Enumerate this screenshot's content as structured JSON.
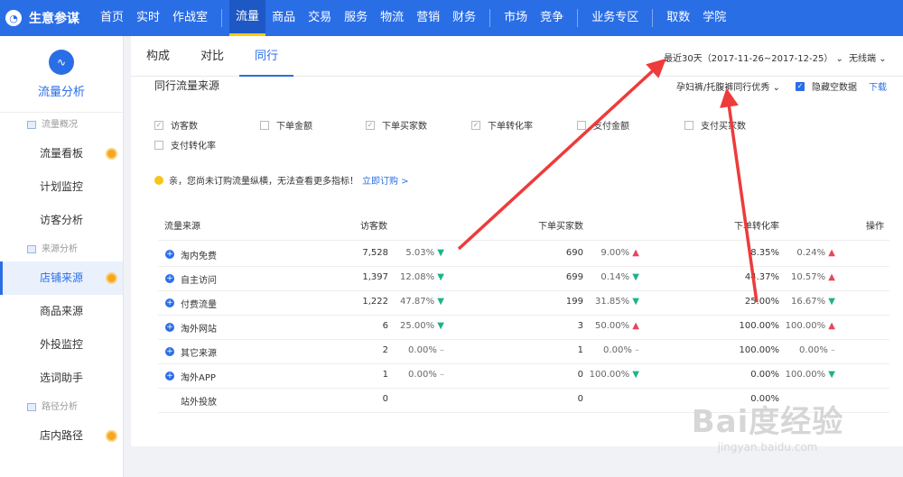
{
  "app": {
    "logo_text": "生意参谋"
  },
  "nav": [
    "首页",
    "实时",
    "作战室",
    "流量",
    "商品",
    "交易",
    "服务",
    "物流",
    "营销",
    "财务",
    "市场",
    "竞争",
    "业务专区",
    "取数",
    "学院"
  ],
  "sidebar": {
    "head_title": "流量分析",
    "groups": [
      {
        "label": "流量概况",
        "items": [
          "流量看板",
          "计划监控",
          "访客分析"
        ]
      },
      {
        "label": "来源分析",
        "items": [
          "店铺来源",
          "商品来源",
          "外投监控",
          "选词助手"
        ]
      },
      {
        "label": "路径分析",
        "items": [
          "店内路径"
        ]
      }
    ]
  },
  "tabs": [
    "构成",
    "对比",
    "同行"
  ],
  "filters": {
    "date_range": "最近30天（2017-11-26~2017-12-25）",
    "device": "无线端",
    "industry": "孕妇裤/托腹裤同行优秀",
    "hide_empty": "隐藏空数据",
    "download": "下载"
  },
  "section_title": "同行流量来源",
  "metrics": [
    {
      "label": "访客数",
      "checked": true
    },
    {
      "label": "下单金额",
      "checked": false
    },
    {
      "label": "下单买家数",
      "checked": true
    },
    {
      "label": "下单转化率",
      "checked": true
    },
    {
      "label": "支付金额",
      "checked": false
    },
    {
      "label": "支付买家数",
      "checked": false
    },
    {
      "label": "支付转化率",
      "checked": false
    }
  ],
  "notice": {
    "text": "亲，您尚未订购流量纵横，无法查看更多指标！",
    "link": "立即订购 >"
  },
  "table": {
    "headers": {
      "source": "流量来源",
      "visitors": "访客数",
      "buyers": "下单买家数",
      "conversion": "下单转化率",
      "action": "操作"
    },
    "rows": [
      {
        "name": "淘内免费",
        "visitors": "7,528",
        "v_pct": "5.03%",
        "v_dir": "down",
        "buyers": "690",
        "b_pct": "9.00%",
        "b_dir": "up",
        "conv": "8.35%",
        "c_pct": "0.24%",
        "c_dir": "up",
        "expand": true
      },
      {
        "name": "自主访问",
        "visitors": "1,397",
        "v_pct": "12.08%",
        "v_dir": "down",
        "buyers": "699",
        "b_pct": "0.14%",
        "b_dir": "down",
        "conv": "44.37%",
        "c_pct": "10.57%",
        "c_dir": "up",
        "expand": true
      },
      {
        "name": "付费流量",
        "visitors": "1,222",
        "v_pct": "47.87%",
        "v_dir": "down",
        "buyers": "199",
        "b_pct": "31.85%",
        "b_dir": "down",
        "conv": "25.00%",
        "c_pct": "16.67%",
        "c_dir": "down",
        "expand": true
      },
      {
        "name": "淘外网站",
        "visitors": "6",
        "v_pct": "25.00%",
        "v_dir": "down",
        "buyers": "3",
        "b_pct": "50.00%",
        "b_dir": "up",
        "conv": "100.00%",
        "c_pct": "100.00%",
        "c_dir": "up",
        "expand": true
      },
      {
        "name": "其它来源",
        "visitors": "2",
        "v_pct": "0.00%",
        "v_dir": "flat",
        "buyers": "1",
        "b_pct": "0.00%",
        "b_dir": "flat",
        "conv": "100.00%",
        "c_pct": "0.00%",
        "c_dir": "flat",
        "expand": true
      },
      {
        "name": "淘外APP",
        "visitors": "1",
        "v_pct": "0.00%",
        "v_dir": "flat",
        "buyers": "0",
        "b_pct": "100.00%",
        "b_dir": "down",
        "conv": "0.00%",
        "c_pct": "100.00%",
        "c_dir": "down",
        "expand": true
      },
      {
        "name": "站外投放",
        "visitors": "0",
        "v_pct": "",
        "v_dir": "",
        "buyers": "0",
        "b_pct": "",
        "b_dir": "",
        "conv": "0.00%",
        "c_pct": "",
        "c_dir": "",
        "expand": false
      }
    ]
  },
  "watermark": {
    "main": "Bai度经验",
    "sub": "jingyan.baidu.com"
  },
  "colors": {
    "primary": "#2a6ee6",
    "up": "#e8455b",
    "down": "#1bb38a",
    "annotation_arrow": "#ee3b3b"
  }
}
